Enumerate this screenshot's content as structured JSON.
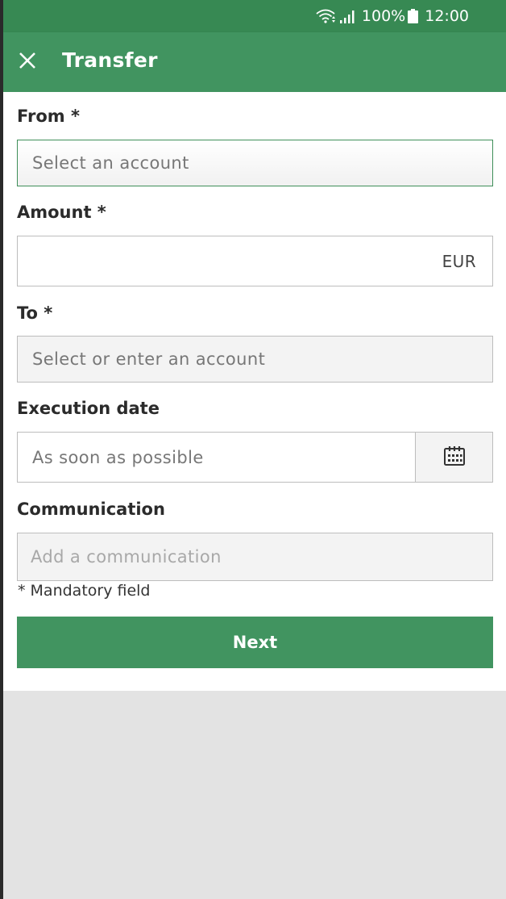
{
  "status_bar": {
    "battery_text": "100%",
    "time": "12:00",
    "icons": [
      "wifi-icon",
      "signal-icon",
      "battery-icon"
    ]
  },
  "app_bar": {
    "title": "Transfer",
    "close_icon": "close-icon"
  },
  "form": {
    "from": {
      "label": "From *",
      "placeholder": "Select an account"
    },
    "amount": {
      "label": "Amount *",
      "value": "",
      "currency": "EUR"
    },
    "to": {
      "label": "To *",
      "placeholder": "Select or enter an account"
    },
    "execution_date": {
      "label": "Execution date",
      "value": "As soon as possible",
      "button_icon": "calendar-icon"
    },
    "communication": {
      "label": "Communication",
      "placeholder": "Add a communication"
    },
    "mandatory_note": "* Mandatory field",
    "next_label": "Next"
  },
  "colors": {
    "status_bar": "#378953",
    "app_bar": "#419460",
    "accent": "#419460",
    "background": "#e3e3e3"
  }
}
